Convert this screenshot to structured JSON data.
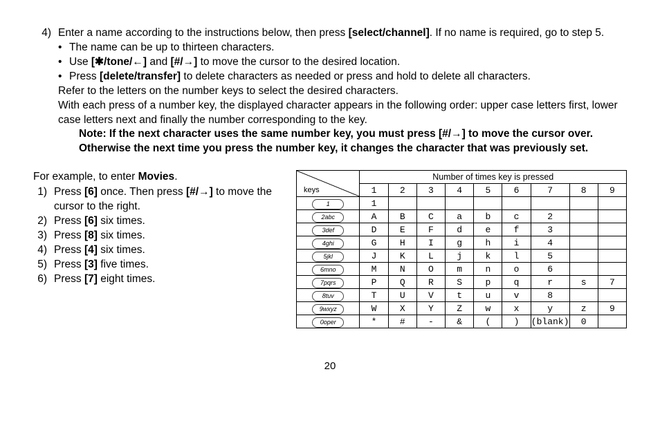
{
  "step4": {
    "num": "4)",
    "line1a": "Enter a name according to the instructions below, then press ",
    "line1b_bold": "[select/channel]",
    "line1c": ". If no name is required, go to step 5.",
    "bullet1": "The name can be up to thirteen characters.",
    "bullet2a": "Use ",
    "bullet2b_bold": "[✱/tone/←]",
    "bullet2c": " and ",
    "bullet2d_bold": "[#/→]",
    "bullet2e": " to move the cursor to the desired location.",
    "bullet3a": "Press ",
    "bullet3b_bold": "[delete/transfer]",
    "bullet3c": " to delete characters as needed or press and hold to delete all characters.",
    "refer": "Refer to the letters on the number keys to select the desired characters.",
    "press_order": "With each press of a number key, the displayed character appears in the following order: upper case letters first, lower case letters next and finally the number corresponding to the key.",
    "note1": "Note: If the next character uses the same number key, you must press [#/→] to move the cursor over.",
    "note2": "Otherwise the next time you press the number key, it changes the character that was previously set."
  },
  "example": {
    "intro_a": "For example, to enter ",
    "intro_bold": "Movies",
    "intro_c": ".",
    "steps": [
      {
        "n": "1)",
        "a": "Press ",
        "b": "[6]",
        "c": " once. Then press ",
        "d": "[#/→]",
        "e": " to move the cursor to the right."
      },
      {
        "n": "2)",
        "a": "Press ",
        "b": "[6]",
        "c": " six times.",
        "d": "",
        "e": ""
      },
      {
        "n": "3)",
        "a": "Press ",
        "b": "[8]",
        "c": " six times.",
        "d": "",
        "e": ""
      },
      {
        "n": "4)",
        "a": "Press ",
        "b": "[4]",
        "c": " six times.",
        "d": "",
        "e": ""
      },
      {
        "n": "5)",
        "a": "Press ",
        "b": "[3]",
        "c": " five times.",
        "d": "",
        "e": ""
      },
      {
        "n": "6)",
        "a": "Press ",
        "b": "[7]",
        "c": " eight times.",
        "d": "",
        "e": ""
      }
    ]
  },
  "chart_data": {
    "type": "table",
    "title": "Number of times key is pressed",
    "keys_label": "keys",
    "columns": [
      "1",
      "2",
      "3",
      "4",
      "5",
      "6",
      "7",
      "8",
      "9"
    ],
    "rows": [
      {
        "key": "1",
        "cells": [
          "1",
          "",
          "",
          "",
          "",
          "",
          "",
          "",
          ""
        ]
      },
      {
        "key": "2abc",
        "cells": [
          "A",
          "B",
          "C",
          "a",
          "b",
          "c",
          "2",
          "",
          ""
        ]
      },
      {
        "key": "3def",
        "cells": [
          "D",
          "E",
          "F",
          "d",
          "e",
          "f",
          "3",
          "",
          ""
        ]
      },
      {
        "key": "4ghi",
        "cells": [
          "G",
          "H",
          "I",
          "g",
          "h",
          "i",
          "4",
          "",
          ""
        ]
      },
      {
        "key": "5jkl",
        "cells": [
          "J",
          "K",
          "L",
          "j",
          "k",
          "l",
          "5",
          "",
          ""
        ]
      },
      {
        "key": "6mno",
        "cells": [
          "M",
          "N",
          "O",
          "m",
          "n",
          "o",
          "6",
          "",
          ""
        ]
      },
      {
        "key": "7pqrs",
        "cells": [
          "P",
          "Q",
          "R",
          "S",
          "p",
          "q",
          "r",
          "s",
          "7"
        ]
      },
      {
        "key": "8tuv",
        "cells": [
          "T",
          "U",
          "V",
          "t",
          "u",
          "v",
          "8",
          "",
          ""
        ]
      },
      {
        "key": "9wxyz",
        "cells": [
          "W",
          "X",
          "Y",
          "Z",
          "w",
          "x",
          "y",
          "z",
          "9"
        ]
      },
      {
        "key": "0oper",
        "cells": [
          "*",
          "#",
          "-",
          "&",
          "(",
          ")",
          "(blank)",
          "0",
          ""
        ]
      }
    ]
  },
  "page_number": "20"
}
